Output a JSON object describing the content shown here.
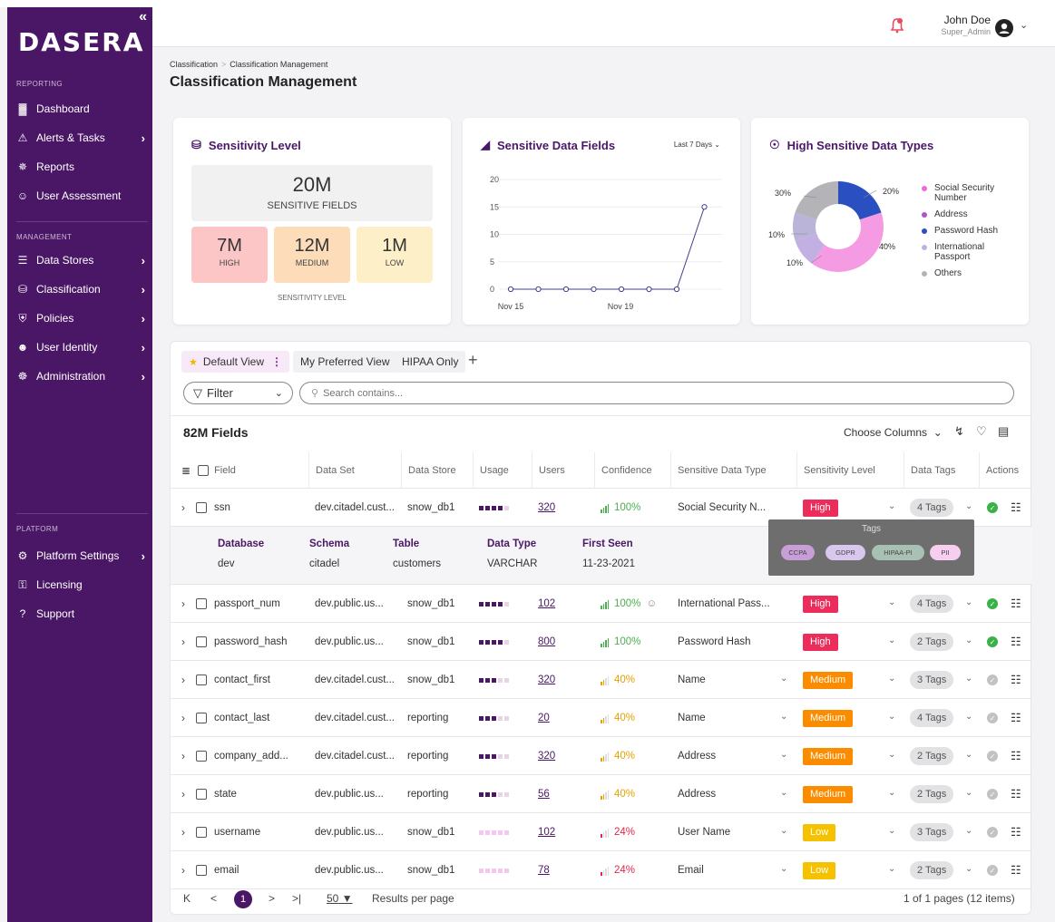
{
  "brand": {
    "logo": "DASERA",
    "collapse": "«",
    "accent": "#4a1766"
  },
  "sidebar": {
    "reporting_label": "REPORTING",
    "management_label": "MANAGEMENT",
    "platform_label": "PLATFORM",
    "reporting": [
      {
        "label": "Dashboard",
        "icon": "bar-chart-icon"
      },
      {
        "label": "Alerts & Tasks",
        "icon": "warning-icon",
        "has_children": true
      },
      {
        "label": "Reports",
        "icon": "pulse-icon"
      },
      {
        "label": "User Assessment",
        "icon": "user-check-icon"
      }
    ],
    "management": [
      {
        "label": "Data Stores",
        "icon": "list-icon",
        "has_children": true
      },
      {
        "label": "Classification",
        "icon": "database-icon",
        "has_children": true
      },
      {
        "label": "Policies",
        "icon": "shield-icon",
        "has_children": true
      },
      {
        "label": "User Identity",
        "icon": "users-icon",
        "has_children": true
      },
      {
        "label": "Administration",
        "icon": "admin-icon",
        "has_children": true
      }
    ],
    "platform": [
      {
        "label": "Platform Settings",
        "icon": "gear-icon",
        "has_children": true
      },
      {
        "label": "Licensing",
        "icon": "key-icon"
      },
      {
        "label": "Support",
        "icon": "help-icon"
      }
    ]
  },
  "header": {
    "user_name": "John Doe",
    "user_role": "Super_Admin"
  },
  "breadcrumb": {
    "items": [
      "Classification",
      "Classification Management"
    ],
    "sep": ">"
  },
  "page_title": "Classification Management",
  "sensitivity_card": {
    "title": "Sensitivity Level",
    "total": "20M",
    "total_label": "SENSITIVE FIELDS",
    "levels": [
      {
        "value": "7M",
        "label": "HIGH",
        "color": "#fcc6c6"
      },
      {
        "value": "12M",
        "label": "MEDIUM",
        "color": "#fddcba"
      },
      {
        "value": "1M",
        "label": "LOW",
        "color": "#fdf0c8"
      }
    ],
    "footer": "SENSITIVITY LEVEL"
  },
  "fields_card": {
    "title": "Sensitive Data Fields",
    "range": "Last 7 Days",
    "chart_data": {
      "type": "line",
      "x_ticks": [
        "Nov 15",
        "Nov 19"
      ],
      "yticks": [
        0,
        5,
        10,
        15,
        20
      ],
      "ylim": [
        0,
        20
      ],
      "values": [
        0,
        0,
        0,
        0,
        0,
        0,
        0,
        15
      ],
      "color": "#3f3f90"
    }
  },
  "types_card": {
    "title": "High Sensitive Data Types",
    "chart_data": {
      "type": "pie",
      "slices": [
        {
          "label": "Social Security Number",
          "value": 20,
          "color": "#f06ad7"
        },
        {
          "label": "Address",
          "value": 0,
          "color": "#b254c7"
        },
        {
          "label": "Password Hash",
          "value": 20,
          "color": "#2a4fc0"
        },
        {
          "label": "Password Hash 40",
          "value": 40,
          "color": "#f48fe0"
        },
        {
          "label": "International Passport",
          "value": 10,
          "color": "#c3b0e3"
        },
        {
          "label": "Others",
          "value": 10,
          "color": "#b3b3b8"
        }
      ],
      "labels": [
        "30%",
        "20%",
        "40%",
        "10%",
        "10%"
      ]
    },
    "legend": [
      {
        "label": "Social Security Number",
        "color": "#f06ad7"
      },
      {
        "label": "Address",
        "color": "#b254c7"
      },
      {
        "label": "Password Hash",
        "color": "#2a4fc0"
      },
      {
        "label": "International Passport",
        "color": "#c3b0e3"
      },
      {
        "label": "Others",
        "color": "#b3b3b8"
      }
    ]
  },
  "views": {
    "default": "Default View",
    "preferred": "My Preferred View",
    "hipaa": "HIPAA Only",
    "add": "+"
  },
  "filter": {
    "label": "Filter",
    "search_placeholder": "Search contains..."
  },
  "table": {
    "count_label": "82M Fields",
    "choose_columns": "Choose Columns",
    "columns": [
      "Field",
      "Data Set",
      "Data Store",
      "Usage",
      "Users",
      "Confidence",
      "Sensitive Data Type",
      "Sensitivity Level",
      "Data Tags",
      "Actions"
    ],
    "rows": [
      {
        "field": "ssn",
        "dataset": "dev.citadel.cust...",
        "store": "snow_db1",
        "usage": 4,
        "users": "320",
        "confidence": "100%",
        "ctype": "high",
        "type": "Social Security N...",
        "type_dd": false,
        "level": "High",
        "tags": "4 Tags",
        "verified": true
      },
      {
        "field": "passport_num",
        "dataset": "dev.public.us...",
        "store": "snow_db1",
        "usage": 4,
        "users": "102",
        "confidence": "100%",
        "ctype": "high",
        "type": "International Pass...",
        "type_dd": false,
        "level": "High",
        "tags": "4 Tags",
        "verified": true
      },
      {
        "field": "password_hash",
        "dataset": "dev.public.us...",
        "store": "snow_db1",
        "usage": 4,
        "users": "800",
        "confidence": "100%",
        "ctype": "high",
        "type": "Password Hash",
        "type_dd": false,
        "level": "High",
        "tags": "2 Tags",
        "verified": true
      },
      {
        "field": "contact_first",
        "dataset": "dev.citadel.cust...",
        "store": "snow_db1",
        "usage": 3,
        "users": "320",
        "confidence": "40%",
        "ctype": "mid",
        "type": "Name",
        "type_dd": true,
        "level": "Medium",
        "tags": "3 Tags",
        "verified": false
      },
      {
        "field": "contact_last",
        "dataset": "dev.citadel.cust...",
        "store": "reporting",
        "usage": 3,
        "users": "20",
        "confidence": "40%",
        "ctype": "mid",
        "type": "Name",
        "type_dd": true,
        "level": "Medium",
        "tags": "4 Tags",
        "verified": false
      },
      {
        "field": "company_add...",
        "dataset": "dev.citadel.cust...",
        "store": "reporting",
        "usage": 3,
        "users": "320",
        "confidence": "40%",
        "ctype": "mid",
        "type": "Address",
        "type_dd": true,
        "level": "Medium",
        "tags": "2 Tags",
        "verified": false
      },
      {
        "field": "state",
        "dataset": "dev.public.us...",
        "store": "reporting",
        "usage": 3,
        "users": "56",
        "confidence": "40%",
        "ctype": "mid",
        "type": "Address",
        "type_dd": true,
        "level": "Medium",
        "tags": "2 Tags",
        "verified": false
      },
      {
        "field": "username",
        "dataset": "dev.public.us...",
        "store": "snow_db1",
        "usage": 0,
        "users": "102",
        "confidence": "24%",
        "ctype": "low",
        "type": "User Name",
        "type_dd": true,
        "level": "Low",
        "tags": "3 Tags",
        "verified": false
      },
      {
        "field": "email",
        "dataset": "dev.public.us...",
        "store": "snow_db1",
        "usage": 0,
        "users": "78",
        "confidence": "24%",
        "ctype": "low",
        "type": "Email",
        "type_dd": true,
        "level": "Low",
        "tags": "2 Tags",
        "verified": false
      }
    ],
    "detail": {
      "headers": [
        "Database",
        "Schema",
        "Table",
        "Data Type",
        "First Seen"
      ],
      "values": [
        "dev",
        "citadel",
        "customers",
        "VARCHAR",
        "11-23-2021"
      ]
    },
    "tag_popup": {
      "title": "Tags",
      "tags": [
        {
          "label": "CCPA",
          "color": "#c79ed6"
        },
        {
          "label": "GDPR",
          "color": "#d9c8ee"
        },
        {
          "label": "HIPAA-PI",
          "color": "#a9c1b5"
        },
        {
          "label": "PII",
          "color": "#f7cdf0"
        }
      ]
    },
    "level_colors": {
      "High": "#ec2c5a",
      "Medium": "#fb8c00",
      "Low": "#f6c200"
    }
  },
  "pager": {
    "first": "K",
    "prev": "<",
    "current": "1",
    "next": ">",
    "last": ">|",
    "per_page": "50",
    "per_page_label": "Results per page",
    "summary": "1 of 1 pages (12 items)"
  }
}
